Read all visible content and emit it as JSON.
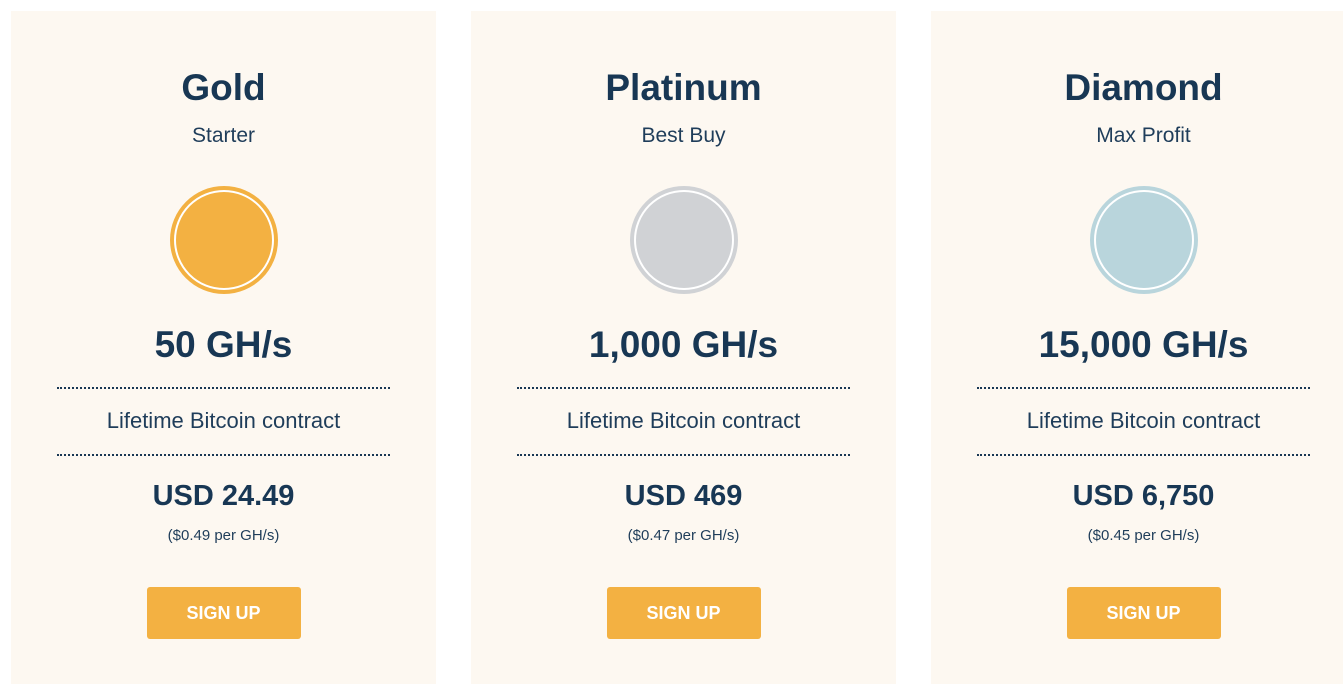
{
  "plans": [
    {
      "name": "Gold",
      "tagline": "Starter",
      "medal_icon": "gold-medal-icon",
      "medal_color": "#f3b142",
      "hashrate": "50 GH/s",
      "contract": "Lifetime Bitcoin contract",
      "price": "USD 24.49",
      "unit_price": "($0.49 per GH/s)",
      "cta_label": "SIGN UP"
    },
    {
      "name": "Platinum",
      "tagline": "Best Buy",
      "medal_icon": "platinum-medal-icon",
      "medal_color": "#d0d2d5",
      "hashrate": "1,000 GH/s",
      "contract": "Lifetime Bitcoin contract",
      "price": "USD 469",
      "unit_price": "($0.47 per GH/s)",
      "cta_label": "SIGN UP"
    },
    {
      "name": "Diamond",
      "tagline": "Max Profit",
      "medal_icon": "diamond-medal-icon",
      "medal_color": "#b9d5dc",
      "hashrate": "15,000 GH/s",
      "contract": "Lifetime Bitcoin contract",
      "price": "USD 6,750",
      "unit_price": "($0.45 per GH/s)",
      "cta_label": "SIGN UP"
    }
  ],
  "colors": {
    "card_background": "#fdf8f1",
    "text_primary": "#183754",
    "button_background": "#f3b142",
    "button_text": "#ffffff"
  }
}
